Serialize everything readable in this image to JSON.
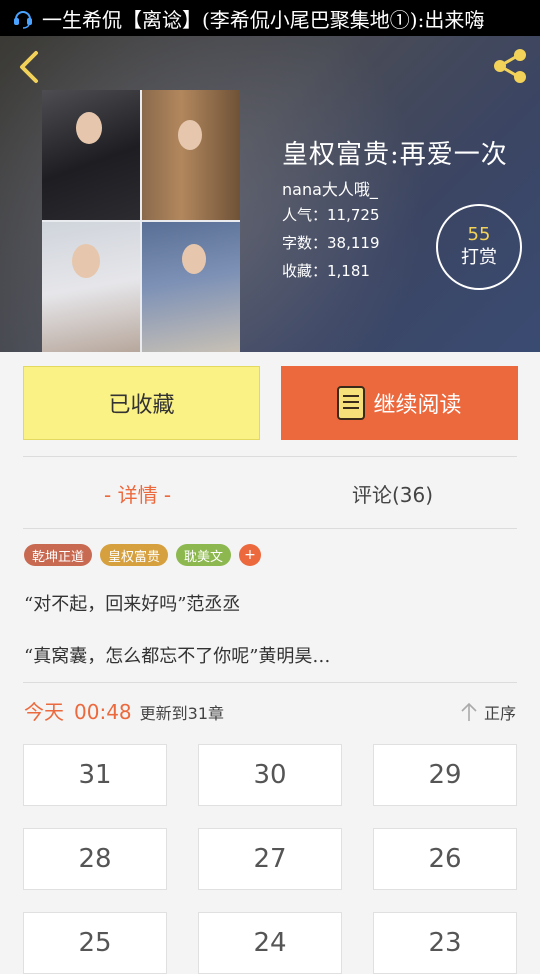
{
  "status_bar": {
    "notification_text": "一生希侃【离谂】(李希侃小尾巴聚集地①):出来嗨"
  },
  "book": {
    "title": "皇权富贵:再爱一次",
    "author": "nana大人哦_",
    "popularity": "人气：11,725",
    "word_count": "字数：38,119",
    "favorites": "收藏：1,181",
    "reward_count": "55",
    "reward_label": "打赏"
  },
  "actions": {
    "favorited_label": "已收藏",
    "continue_label": "继续阅读"
  },
  "tabs": {
    "detail": "- 详情 -",
    "comments": "评论(36)"
  },
  "tags": [
    {
      "label": "乾坤正道",
      "color": "#c86a52"
    },
    {
      "label": "皇权富贵",
      "color": "#d6a03e"
    },
    {
      "label": "耽美文",
      "color": "#8cb84f"
    }
  ],
  "tag_add_label": "+",
  "description": [
    "“对不起，回来好吗”范丞丞",
    "“真窝囊，怎么都忘不了你呢”黄明昊…"
  ],
  "update": {
    "day": "今天",
    "time": "00:48",
    "info": "更新到31章",
    "order_label": "正序"
  },
  "chapters": [
    "31",
    "30",
    "29",
    "28",
    "27",
    "26",
    "25",
    "24",
    "23"
  ],
  "colors": {
    "accent": "#ec693d",
    "favorite_bg": "#fbf285",
    "reward_number": "#f2d259"
  },
  "icons": {
    "status": "headset-icon",
    "back": "back-chevron-icon",
    "share": "share-icon",
    "read": "book-icon",
    "order": "arrow-up-icon"
  }
}
